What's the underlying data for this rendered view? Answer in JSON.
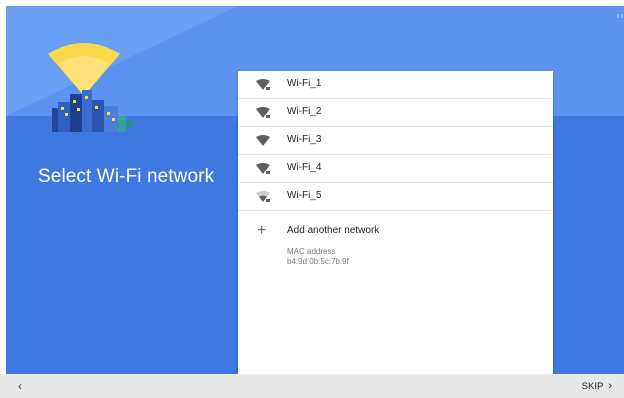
{
  "page": {
    "title": "Select Wi-Fi network"
  },
  "networks": [
    {
      "label": "Wi-Fi_1",
      "icon": "wifi-secured-icon"
    },
    {
      "label": "Wi-Fi_2",
      "icon": "wifi-secured-icon"
    },
    {
      "label": "Wi-Fi_3",
      "icon": "wifi-icon"
    },
    {
      "label": "Wi-Fi_4",
      "icon": "wifi-secured-icon"
    },
    {
      "label": "Wi-Fi_5",
      "icon": "wifi-weak-secured-icon"
    }
  ],
  "add_network": {
    "label": "Add another network",
    "icon": "plus-icon"
  },
  "device": {
    "mac_label": "MAC address",
    "mac_value": "b4:9d:0b:5c:7b:9f"
  },
  "footer": {
    "back_glyph": "‹",
    "skip_label": "SKIP",
    "skip_glyph": "›"
  },
  "colors": {
    "background_dark": "#3e78e0",
    "background_light": "#5d93f0",
    "panel": "#ffffff",
    "bottom_bar": "#e8e8e8",
    "signal_beam": "#fbd94a"
  }
}
